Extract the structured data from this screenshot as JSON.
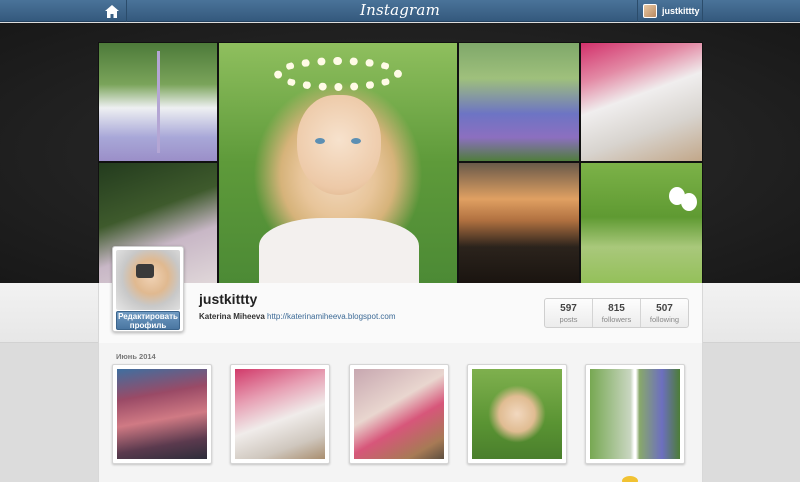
{
  "nav": {
    "logo": "Instagram",
    "home_icon": "home-icon",
    "username": "justkittty"
  },
  "profile": {
    "username": "justkittty",
    "full_name": "Katerina Miheeva",
    "website": "http://katerinamiheeva.blogspot.com",
    "edit_button": "Редактировать профиль",
    "stats": [
      {
        "value": "597",
        "label": "posts"
      },
      {
        "value": "815",
        "label": "followers"
      },
      {
        "value": "507",
        "label": "following"
      }
    ]
  },
  "feed": {
    "month_label": "Июнь 2014",
    "thumbnails": [
      "photo-1",
      "photo-2",
      "photo-3",
      "photo-4",
      "photo-5"
    ]
  },
  "colors": {
    "nav_bar": "#3f6889",
    "link": "#3c6a96",
    "edit_button": "#4a76a1"
  }
}
